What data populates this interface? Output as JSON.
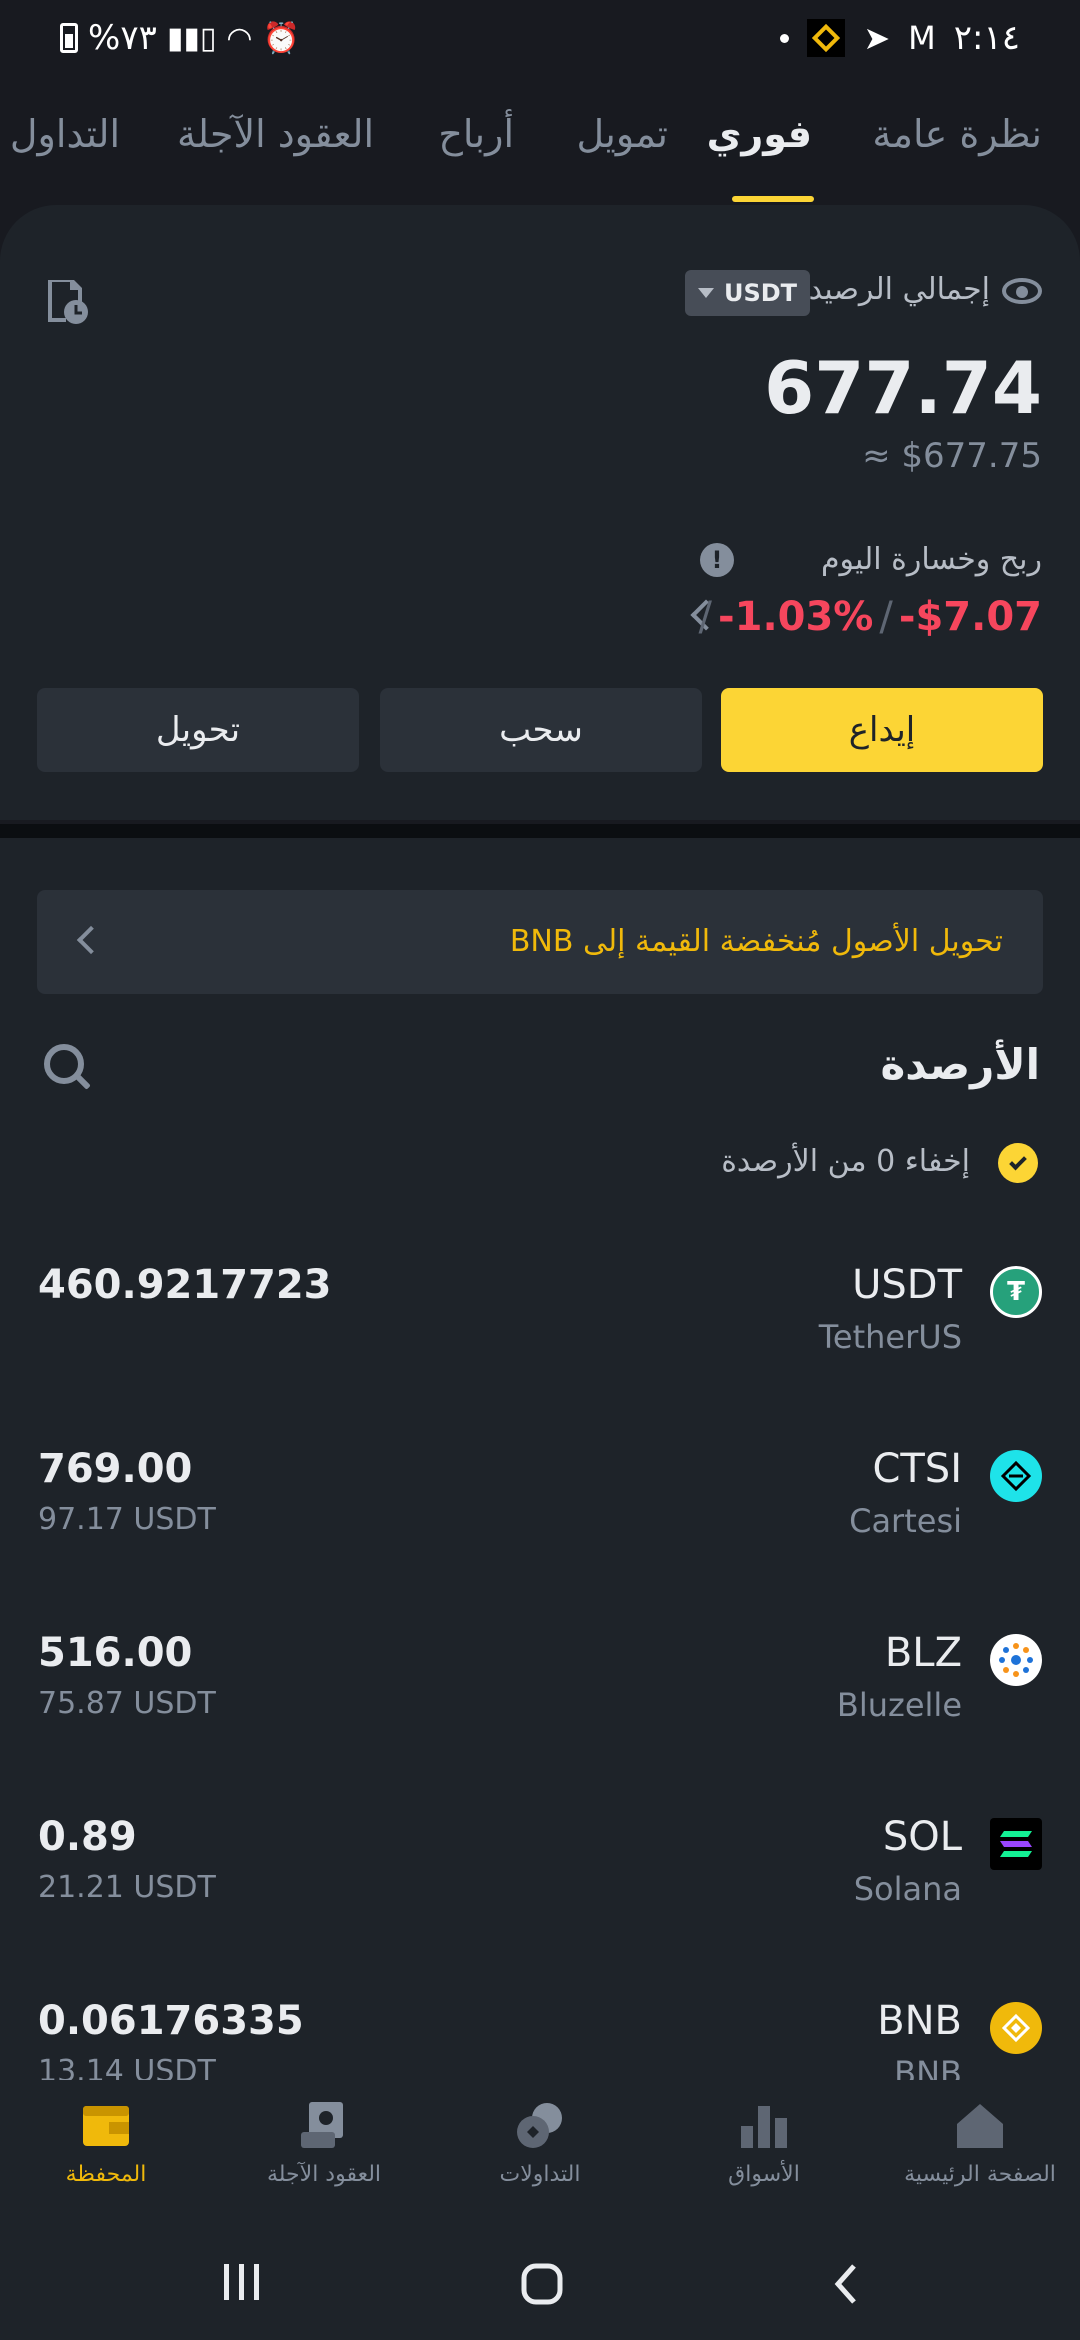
{
  "status_bar": {
    "battery_text": "%٧٣",
    "time": "٢:١٤"
  },
  "tabs": [
    {
      "label": "نظرة عامة"
    },
    {
      "label": "فوري"
    },
    {
      "label": "تمويل"
    },
    {
      "label": "أرباح"
    },
    {
      "label": "العقود الآجلة"
    },
    {
      "label": "التداول ا"
    }
  ],
  "balance": {
    "label": "إجمالي الرصيد",
    "currency": "USDT",
    "amount": "677.74",
    "approx": "≈ $677.75",
    "pnl_label": "ربح وخسارة اليوم",
    "pnl_amount": "-$7.07",
    "pnl_percent": "-1.03%"
  },
  "actions": {
    "deposit": "إيداع",
    "withdraw": "سحب",
    "transfer": "تحويل"
  },
  "banner": {
    "text": "تحويل الأصول مُنخفضة القيمة إلى BNB"
  },
  "balances_section": {
    "title": "الأرصدة",
    "hide_zero": "إخفاء 0 من الأرصدة"
  },
  "assets": [
    {
      "symbol": "USDT",
      "name": "TetherUS",
      "amount": "460.9217723",
      "value": ""
    },
    {
      "symbol": "CTSI",
      "name": "Cartesi",
      "amount": "769.00",
      "value": "97.17 USDT"
    },
    {
      "symbol": "BLZ",
      "name": "Bluzelle",
      "amount": "516.00",
      "value": "75.87 USDT"
    },
    {
      "symbol": "SOL",
      "name": "Solana",
      "amount": "0.89",
      "value": "21.21 USDT"
    },
    {
      "symbol": "BNB",
      "name": "BNB",
      "amount": "0.06176335",
      "value": "13.14 USDT"
    }
  ],
  "bottom_nav": [
    {
      "label": "الصفحة الرئيسية",
      "icon": "home-icon"
    },
    {
      "label": "الأسواق",
      "icon": "markets-icon"
    },
    {
      "label": "التداولات",
      "icon": "trades-icon"
    },
    {
      "label": "العقود الآجلة",
      "icon": "futures-icon"
    },
    {
      "label": "المحفظة",
      "icon": "wallet-icon"
    }
  ],
  "colors": {
    "accent": "#fcd535",
    "negative": "#f6465d",
    "background": "#181a20",
    "card": "#1e2329"
  }
}
